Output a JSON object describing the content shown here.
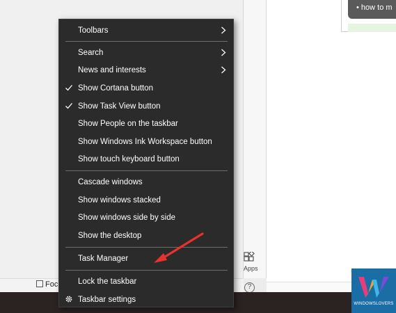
{
  "context_menu": {
    "items": [
      {
        "label": "Toolbars",
        "submenu": true,
        "checked": false
      },
      {
        "label": "Search",
        "submenu": true,
        "checked": false
      },
      {
        "label": "News and interests",
        "submenu": true,
        "checked": false
      },
      {
        "label": "Show Cortana button",
        "submenu": false,
        "checked": true
      },
      {
        "label": "Show Task View button",
        "submenu": false,
        "checked": true
      },
      {
        "label": "Show People on the taskbar",
        "submenu": false,
        "checked": false
      },
      {
        "label": "Show Windows Ink Workspace button",
        "submenu": false,
        "checked": false
      },
      {
        "label": "Show touch keyboard button",
        "submenu": false,
        "checked": false
      },
      {
        "label": "Cascade windows",
        "submenu": false,
        "checked": false
      },
      {
        "label": "Show windows stacked",
        "submenu": false,
        "checked": false
      },
      {
        "label": "Show windows side by side",
        "submenu": false,
        "checked": false
      },
      {
        "label": "Show the desktop",
        "submenu": false,
        "checked": false
      },
      {
        "label": "Task Manager",
        "submenu": false,
        "checked": false
      },
      {
        "label": "Lock the taskbar",
        "submenu": false,
        "checked": false
      },
      {
        "label": "Taskbar settings",
        "submenu": false,
        "checked": false,
        "icon": "gear-icon"
      }
    ]
  },
  "background": {
    "tooltip_text": "• how to m",
    "focus_label": "Focu",
    "apps_label": "Apps",
    "help_glyph": "?"
  },
  "watermark": {
    "text": "WINDOWSLOVERS"
  },
  "colors": {
    "menu_background": "#2b2b2b",
    "menu_text": "#ffffff",
    "separator": "#6e6e6e",
    "annotation_arrow": "#e8322e",
    "taskbar": "#2b2222",
    "watermark_background": "#1b6da6"
  }
}
